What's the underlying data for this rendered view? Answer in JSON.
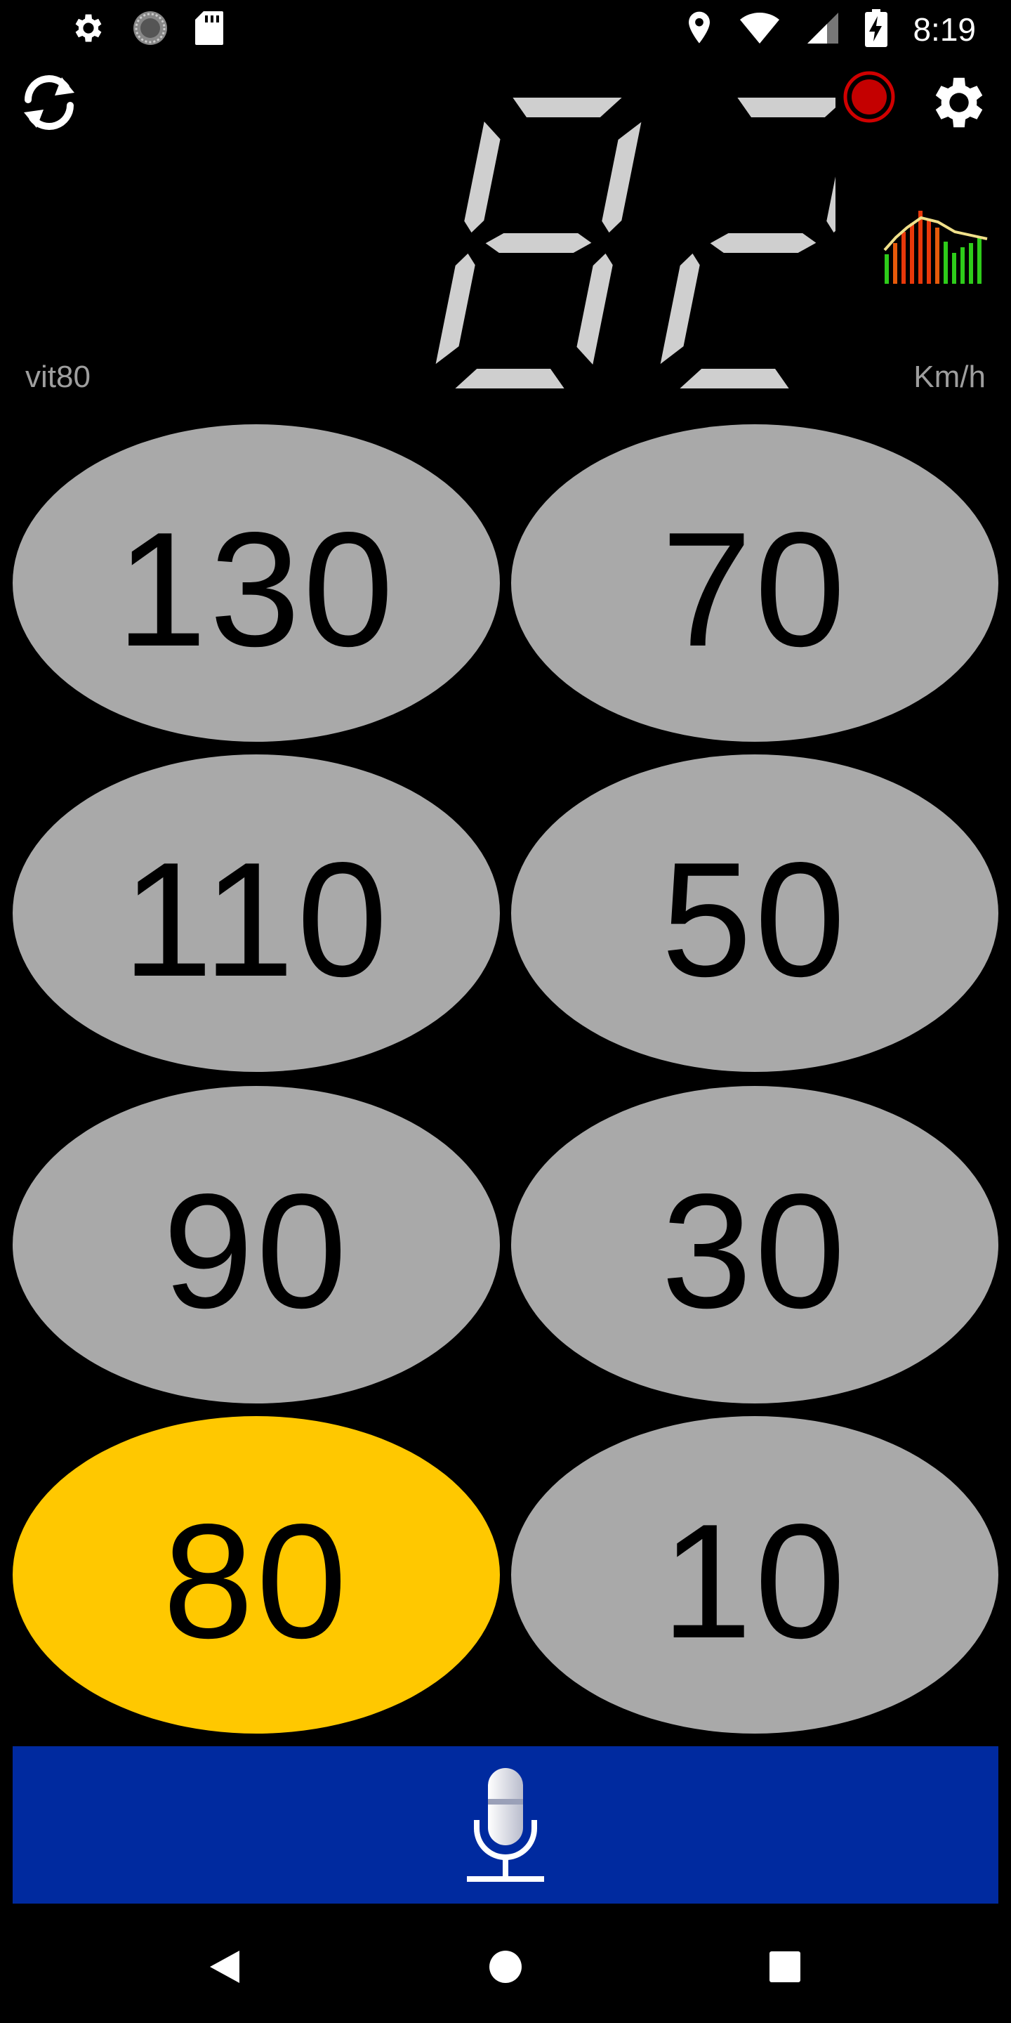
{
  "status_bar": {
    "time": "8:19",
    "left_icons": [
      "gear-icon",
      "loading-spinner-icon",
      "sd-card-icon"
    ],
    "right_icons": [
      "location-pin-icon",
      "wifi-icon",
      "cell-signal-icon",
      "battery-charging-icon"
    ]
  },
  "speedometer": {
    "speed_value": "82",
    "unit_label": "Km/h",
    "profile_label": "vit80"
  },
  "speed_buttons": [
    {
      "label": "130",
      "active": false
    },
    {
      "label": "70",
      "active": false
    },
    {
      "label": "110",
      "active": false
    },
    {
      "label": "50",
      "active": false
    },
    {
      "label": "90",
      "active": false
    },
    {
      "label": "30",
      "active": false
    },
    {
      "label": "80",
      "active": true
    },
    {
      "label": "10",
      "active": false
    }
  ],
  "colors": {
    "background": "#000000",
    "button_inactive": "#a9a9a9",
    "button_active": "#ffc800",
    "mic_bar": "#002a9f",
    "record_red": "#d00000",
    "segment_gray": "#cfcfcf"
  },
  "icons": {
    "refresh": "refresh-icon",
    "settings": "gear-icon",
    "record": "record-icon",
    "graph": "speed-graph-icon",
    "mic": "microphone-icon"
  },
  "nav_bar": {
    "buttons": [
      "back-icon",
      "home-icon",
      "recents-icon"
    ]
  }
}
